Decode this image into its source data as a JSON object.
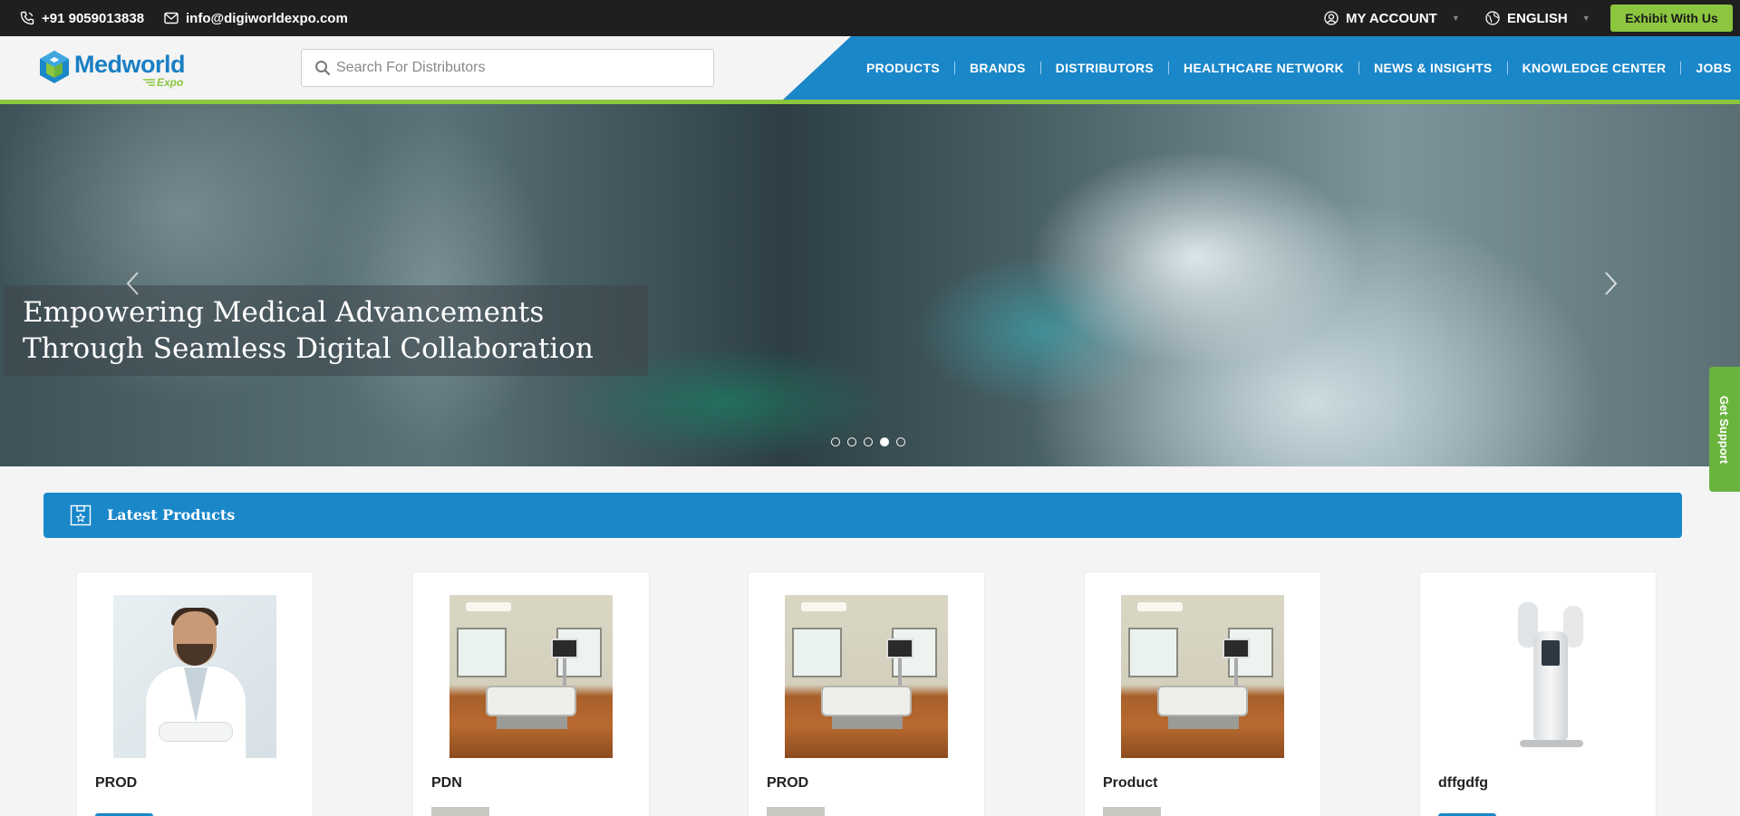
{
  "topbar": {
    "phone": "+91 9059013838",
    "email": "info@digiworldexpo.com",
    "account_label": "MY ACCOUNT",
    "language_label": "ENGLISH",
    "exhibit_button": "Exhibit With Us"
  },
  "header": {
    "logo_word": "Medworld",
    "logo_sub": "Expo",
    "search_placeholder": "Search For Distributors",
    "nav": [
      "PRODUCTS",
      "BRANDS",
      "DISTRIBUTORS",
      "HEALTHCARE NETWORK",
      "NEWS & INSIGHTS",
      "KNOWLEDGE CENTER",
      "JOBS"
    ]
  },
  "hero": {
    "caption_line1": "Empowering Medical Advancements",
    "caption_line2": "Through Seamless Digital Collaboration",
    "slide_count": 5,
    "active_slide": 4
  },
  "support": {
    "label": "Get Support"
  },
  "latest": {
    "title": "Latest Products",
    "products": [
      {
        "name": "PROD",
        "image": "doctor-photo"
      },
      {
        "name": "PDN",
        "image": "hospital-room-photo"
      },
      {
        "name": "PROD",
        "image": "hospital-room-photo"
      },
      {
        "name": "Product",
        "image": "hospital-room-photo"
      },
      {
        "name": "dffgdfg",
        "image": "aesthetic-device-photo"
      }
    ]
  },
  "colors": {
    "brand_blue": "#1a87c9",
    "brand_green": "#8cc63f",
    "topbar_bg": "#1f1f1f"
  }
}
